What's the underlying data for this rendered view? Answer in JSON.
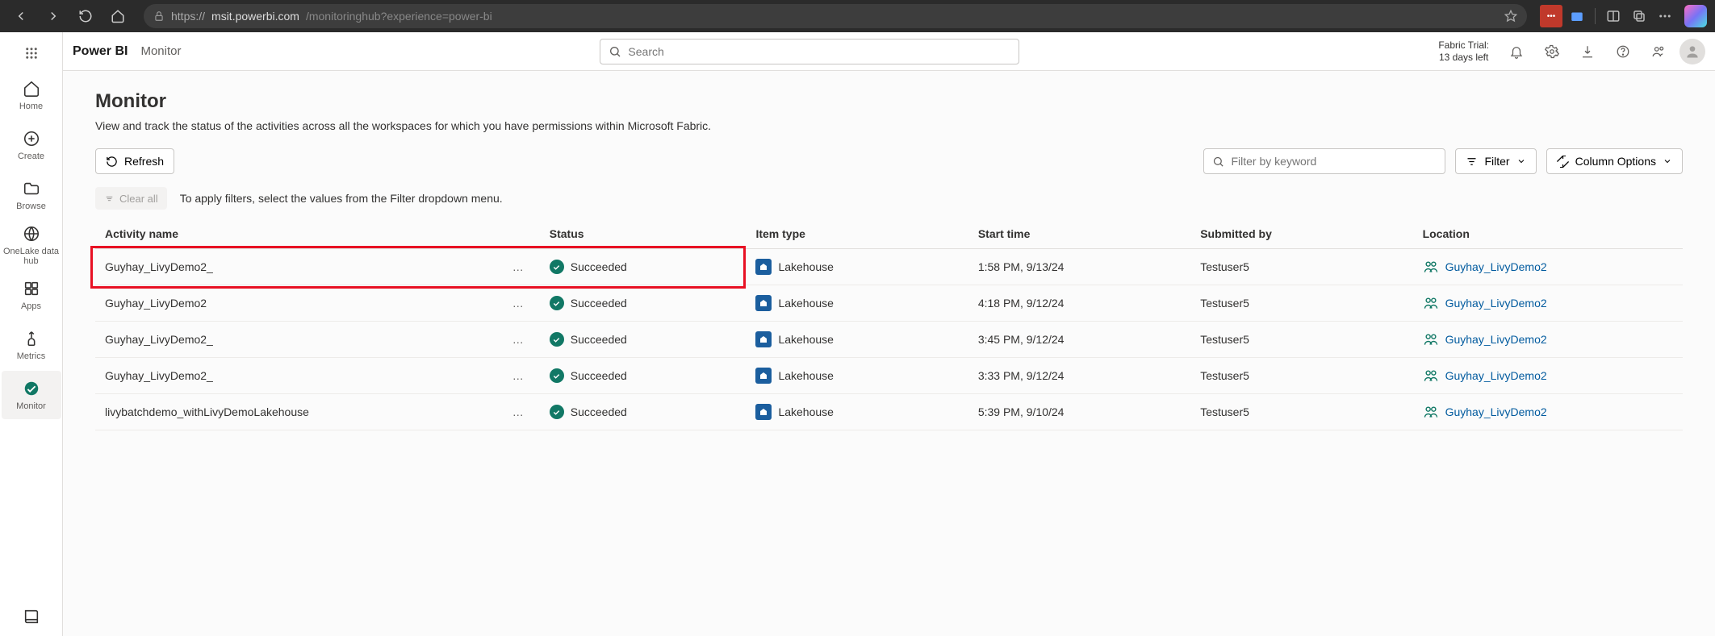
{
  "browser": {
    "url_host": "msit.powerbi.com",
    "url_path": "/monitoringhub?experience=power-bi",
    "url_prefix": "https://"
  },
  "header": {
    "brand": "Power BI",
    "section": "Monitor",
    "search_placeholder": "Search",
    "trial_line1": "Fabric Trial:",
    "trial_line2": "13 days left"
  },
  "rail": {
    "home": "Home",
    "create": "Create",
    "browse": "Browse",
    "onelake": "OneLake data hub",
    "apps": "Apps",
    "metrics": "Metrics",
    "monitor": "Monitor"
  },
  "page": {
    "title": "Monitor",
    "description": "View and track the status of the activities across all the workspaces for which you have permissions within Microsoft Fabric."
  },
  "toolbar": {
    "refresh": "Refresh",
    "filter_placeholder": "Filter by keyword",
    "filter_btn": "Filter",
    "columns_btn": "Column Options",
    "clear_all": "Clear all",
    "clear_hint": "To apply filters, select the values from the Filter dropdown menu."
  },
  "columns": {
    "activity": "Activity name",
    "status": "Status",
    "item_type": "Item type",
    "start_time": "Start time",
    "submitted_by": "Submitted by",
    "location": "Location"
  },
  "status_succeeded": "Succeeded",
  "item_type_lakehouse": "Lakehouse",
  "rows": [
    {
      "name": "Guyhay_LivyDemo2_",
      "start": "1:58 PM, 9/13/24",
      "submitter": "Testuser5",
      "location": "Guyhay_LivyDemo2",
      "highlight": true
    },
    {
      "name": "Guyhay_LivyDemo2",
      "start": "4:18 PM, 9/12/24",
      "submitter": "Testuser5",
      "location": "Guyhay_LivyDemo2"
    },
    {
      "name": "Guyhay_LivyDemo2_",
      "start": "3:45 PM, 9/12/24",
      "submitter": "Testuser5",
      "location": "Guyhay_LivyDemo2"
    },
    {
      "name": "Guyhay_LivyDemo2_",
      "start": "3:33 PM, 9/12/24",
      "submitter": "Testuser5",
      "location": "Guyhay_LivyDemo2"
    },
    {
      "name": "livybatchdemo_withLivyDemoLakehouse",
      "start": "5:39 PM, 9/10/24",
      "submitter": "Testuser5",
      "location": "Guyhay_LivyDemo2"
    }
  ]
}
